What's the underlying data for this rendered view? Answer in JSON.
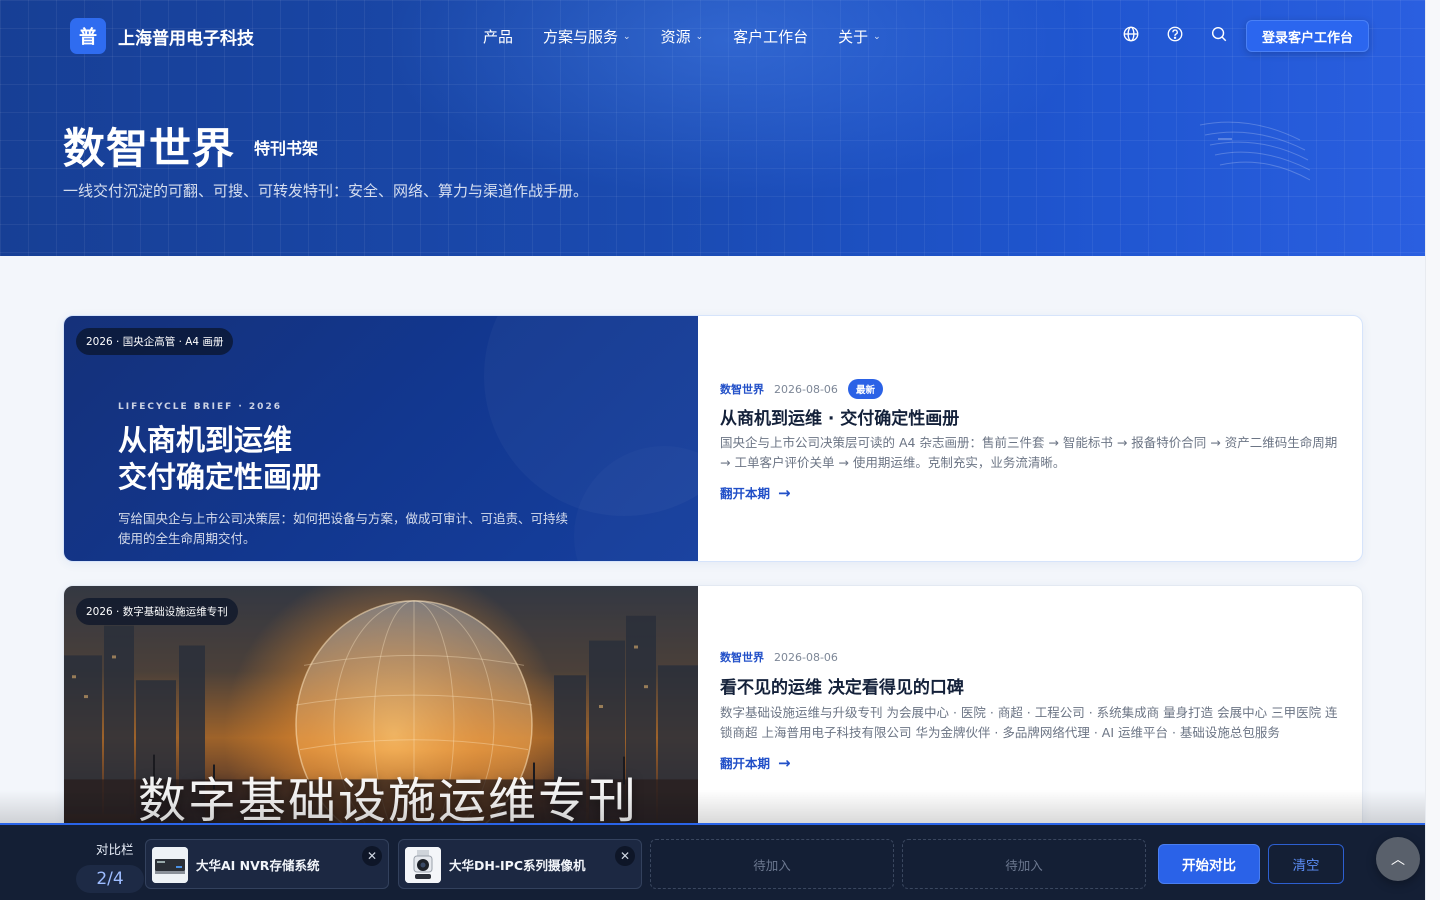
{
  "nav": {
    "logo_char": "普",
    "brand": "上海普用电子科技",
    "menu": [
      {
        "label": "产品",
        "has_dropdown": false
      },
      {
        "label": "方案与服务",
        "has_dropdown": true
      },
      {
        "label": "资源",
        "has_dropdown": true
      },
      {
        "label": "客户工作台",
        "has_dropdown": false
      },
      {
        "label": "关于",
        "has_dropdown": true
      }
    ],
    "icons": [
      "globe-icon",
      "help-icon",
      "search-icon"
    ],
    "login_label": "登录客户工作台"
  },
  "hero": {
    "title": "数智世界",
    "subtitle": "特刊书架",
    "desc": "一线交付沉淀的可翻、可搜、可转发特刊：安全、网络、算力与渠道作战手册。"
  },
  "cards": [
    {
      "cover_tag": "2026 · 国央企高管 · A4 画册",
      "cover_kicker": "LIFECYCLE BRIEF · 2026",
      "cover_title_1": "从商机到运维",
      "cover_title_2": "交付确定性画册",
      "cover_desc": "写给国央企与上市公司决策层：如何把设备与方案，做成可审计、可追责、可持续使用的全生命周期交付。",
      "category": "数智世界",
      "date": "2026-08-06",
      "badge": "最新",
      "title": "从商机到运维 · 交付确定性画册",
      "desc": "国央企与上市公司决策层可读的 A4 杂志画册：售前三件套 → 智能标书 → 报备特价合同 → 资产二维码生命周期 → 工单客户评价关单 → 使用期运维。克制充实，业务流清晰。",
      "link": "翻开本期"
    },
    {
      "cover_tag": "2026 · 数字基础设施运维专刊",
      "cover_title": "数字基础设施运维专刊",
      "category": "数智世界",
      "date": "2026-08-06",
      "title": "看不见的运维 决定看得见的口碑",
      "desc": "数字基础设施运维与升级专刊 为会展中心 · 医院 · 商超 · 工程公司 · 系统集成商 量身打造 会展中心 三甲医院 连锁商超 上海普用电子科技有限公司 华为金牌伙伴 · 多品牌网络代理 · AI 运维平台 · 基础设施总包服务",
      "link": "翻开本期"
    }
  ],
  "compare": {
    "label": "对比栏",
    "count": "2/4",
    "items": [
      {
        "name": "大华AI NVR存储系统",
        "icon": "nvr-device-icon"
      },
      {
        "name": "大华DH-IPC系列摄像机",
        "icon": "camera-device-icon"
      }
    ],
    "empty_label_1": "待加入",
    "empty_label_2": "待加入",
    "compare_label": "开始对比",
    "clear_label": "清空"
  },
  "colors": {
    "brand_blue": "#2b66ef",
    "hero_dark": "#173f95",
    "compare_bg": "#141f35"
  }
}
